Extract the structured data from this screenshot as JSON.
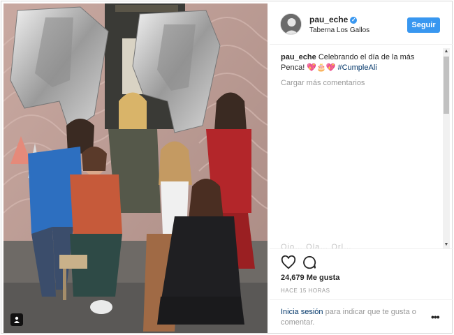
{
  "post": {
    "username": "pau_eche",
    "verified": true,
    "location": "Taberna Los Gallos",
    "follow_label": "Seguir",
    "caption_author": "pau_eche",
    "caption_text": "Celebrando el día de la más Penca! 💖🎂💖",
    "caption_hashtag": "#CumpleAli",
    "load_more": "Cargar más comentarios",
    "faded_comment": "Ojo…  Ola…  Orl…",
    "likes": "24,679 Me gusta",
    "time": "HACE 15 HORAS",
    "login_link": "Inicia sesión",
    "login_rest": " para indicar que te gusta o comentar.",
    "more_label": "•••"
  },
  "icons": {
    "like": "heart-icon",
    "comment": "comment-icon",
    "user_tag": "user-tag-icon",
    "verified": "verified-badge-icon",
    "more": "more-options-icon"
  },
  "colors": {
    "accent": "#3897f0",
    "link": "#003569",
    "muted": "#999999",
    "text": "#262626"
  }
}
